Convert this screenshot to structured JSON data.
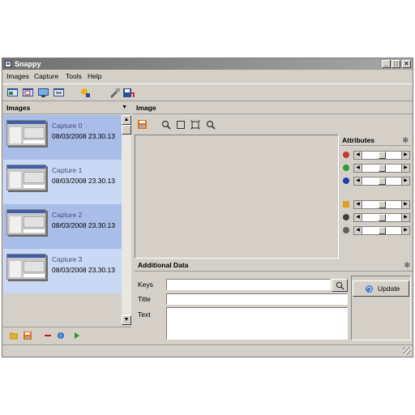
{
  "window": {
    "title": "Snappy",
    "controls": [
      "_",
      "□",
      "×"
    ]
  },
  "menu": [
    "Images",
    "Capture",
    "Tools",
    "Help"
  ],
  "toolbar": {
    "icons": [
      "capture-window-icon",
      "capture-region-icon",
      "capture-screen-icon",
      "capture-object-icon",
      "wizard-icon",
      "tools-icon",
      "export-icon"
    ]
  },
  "images_panel": {
    "title": "Images",
    "items": [
      {
        "name": "Capture 0",
        "date": "08/03/2008 23.30.13"
      },
      {
        "name": "Capture 1",
        "date": "08/03/2008 23.30.13"
      },
      {
        "name": "Capture 2",
        "date": "08/03/2008 23.30.13"
      },
      {
        "name": "Capture 3",
        "date": "08/03/2008 23.30.13"
      }
    ],
    "bottom_icons": [
      "open-folder-icon",
      "save-icon",
      "remove-icon",
      "web-icon",
      "play-icon"
    ]
  },
  "image_panel": {
    "title": "Image",
    "tool_icons": [
      "save-image-icon",
      "zoom-in-icon",
      "fit-icon",
      "actual-size-icon",
      "zoom-out-icon"
    ]
  },
  "attributes": {
    "title": "Attributes",
    "sliders": [
      {
        "icon": "red-channel-icon",
        "color": "#c0392b",
        "value": 0.5
      },
      {
        "icon": "green-channel-icon",
        "color": "#2e9b3a",
        "value": 0.5
      },
      {
        "icon": "blue-channel-icon",
        "color": "#1f3fa8",
        "value": 0.5
      },
      {
        "icon": "brightness-icon",
        "color": "#e0a020",
        "value": 0.5
      },
      {
        "icon": "contrast-icon",
        "color": "#404040",
        "value": 0.5
      },
      {
        "icon": "gamma-icon",
        "color": "#606060",
        "value": 0.5
      }
    ]
  },
  "additional_data": {
    "title": "Additional Data",
    "keys_label": "Keys",
    "title_label": "Title",
    "text_label": "Text",
    "keys_value": "",
    "title_value": "",
    "text_value": "",
    "update_label": "Update"
  },
  "colors": {
    "selected_item": "#a9bde8",
    "item": "#c9d8f4",
    "title_bar": "#7a7a7a"
  }
}
